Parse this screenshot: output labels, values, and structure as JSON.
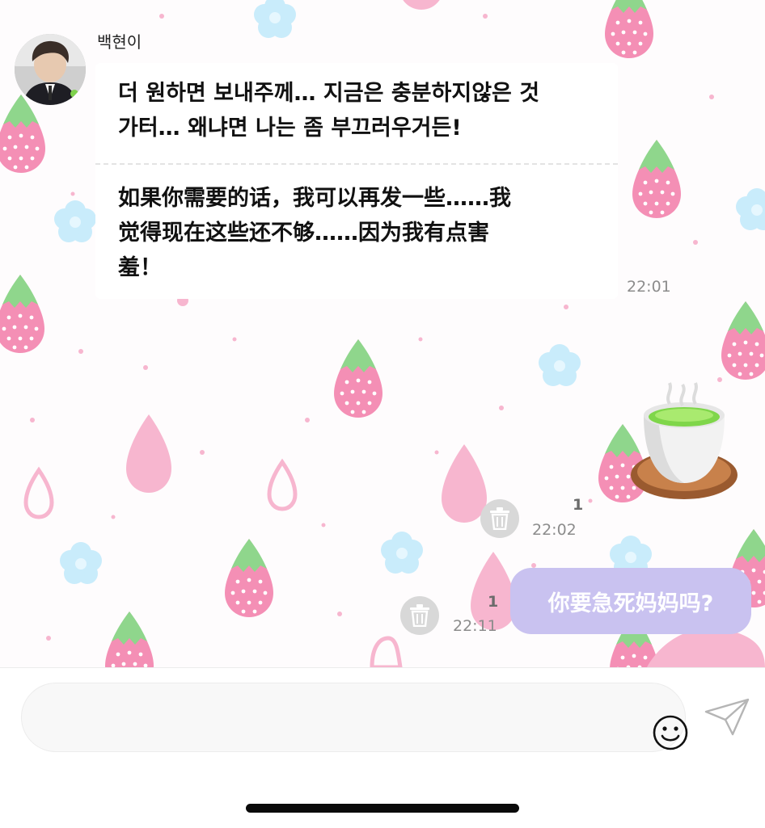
{
  "chat": {
    "sender_name": "백현이",
    "incoming": {
      "text_ko": "더 원하면 보내주께… 지금은 충분하지않은 것\n가터… 왜냐면 나는 좀 부끄러우거든!",
      "text_zh": "如果你需要的话，我可以再发一些……我\n觉得现在这些还不够……因为我有点害\n羞！",
      "time": "22:01"
    },
    "outgoing": [
      {
        "type": "emoji-sticker",
        "emoji": "teacup-icon",
        "unread": "1",
        "time": "22:02"
      },
      {
        "type": "text",
        "text": "你要急死妈妈吗?",
        "unread": "1",
        "time": "22:11"
      }
    ]
  },
  "input": {
    "value": "",
    "placeholder": ""
  },
  "colors": {
    "outgoing_bubble": "#c9c2f0",
    "strawberry_pink": "#f48fb5",
    "leaf_green": "#8fd68c",
    "flower_blue": "#c9ecfb"
  },
  "icons": {
    "delete": "trash-icon",
    "emoji": "smiley-icon",
    "send": "paper-plane-icon"
  }
}
